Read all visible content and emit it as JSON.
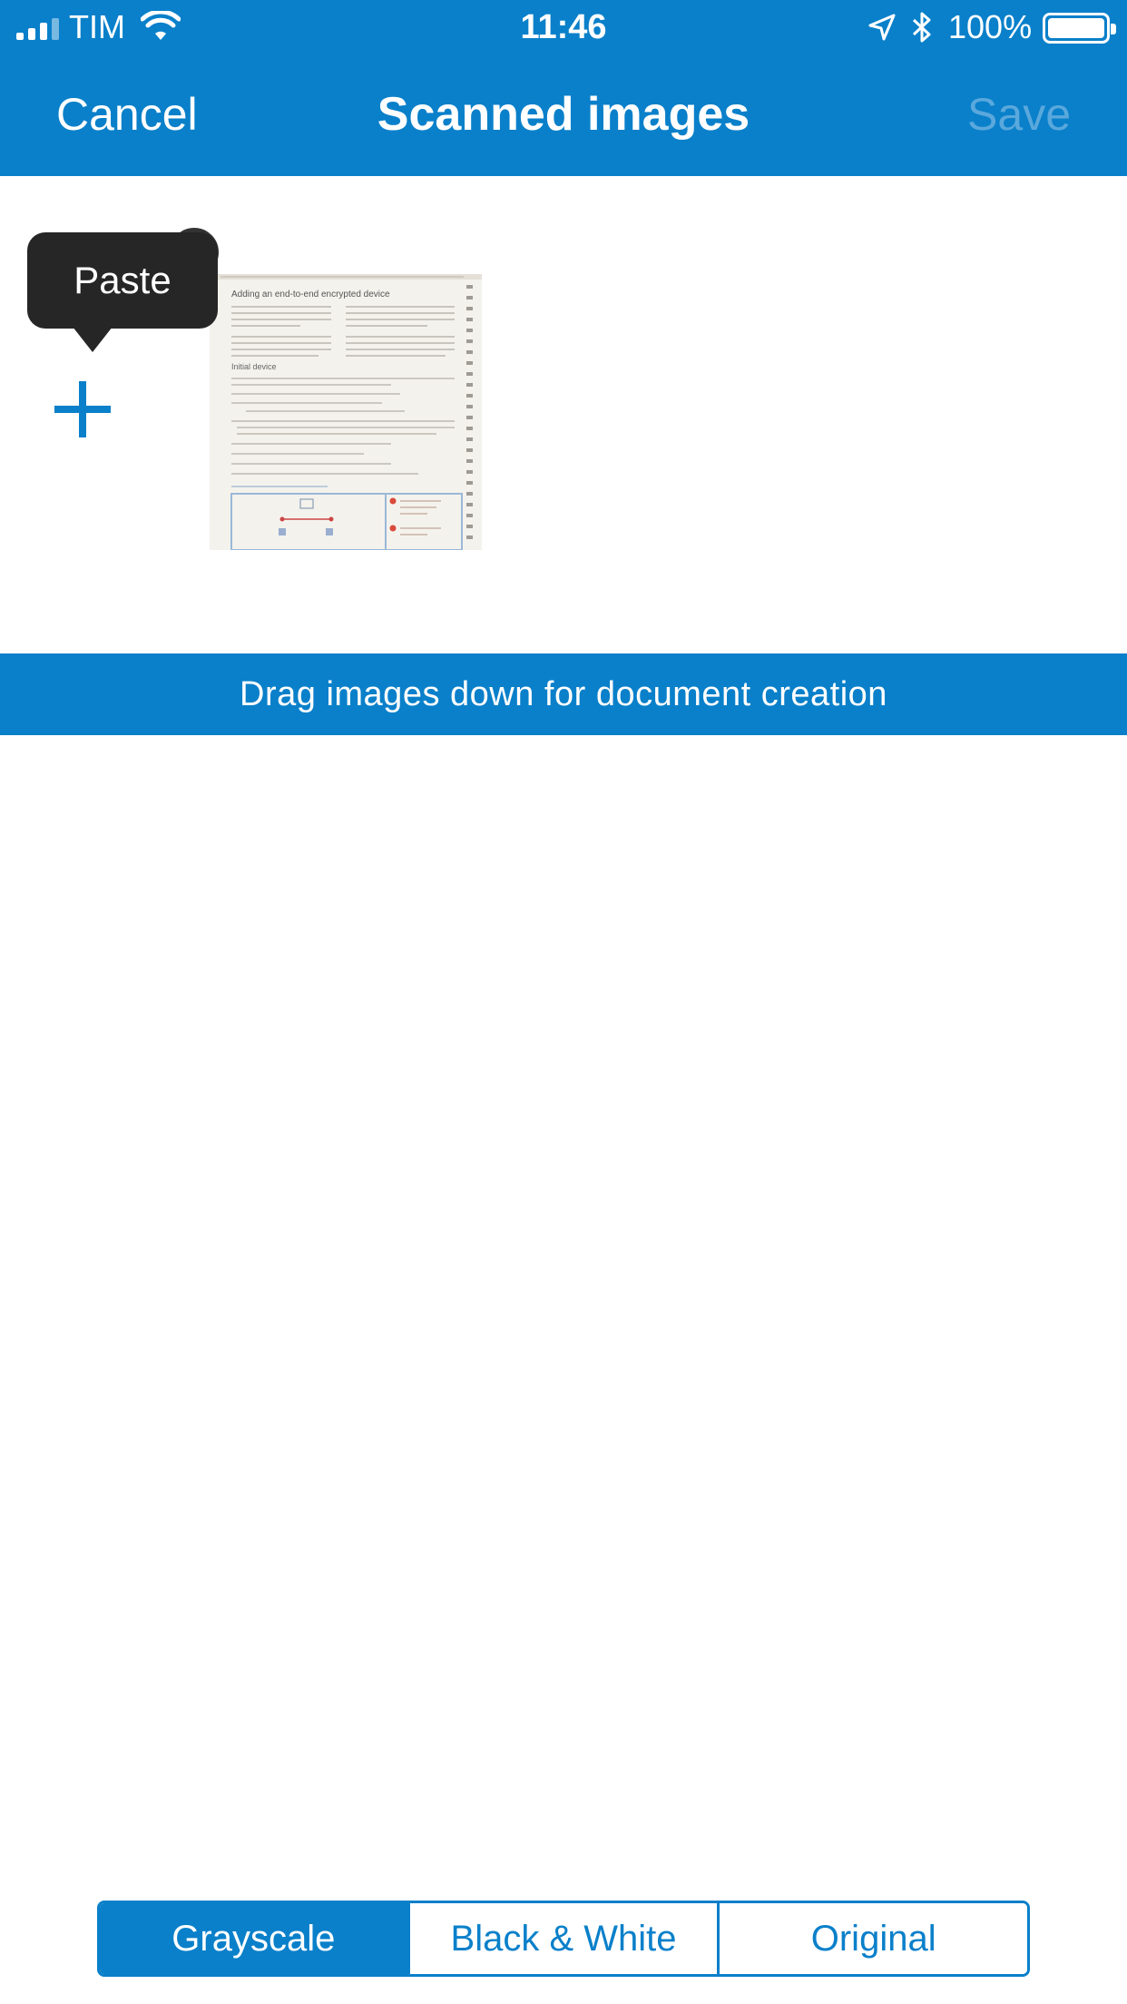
{
  "status_bar": {
    "carrier": "TIM",
    "time": "11:46",
    "battery_percent": "100%",
    "icons": [
      "signal-icon",
      "wifi-icon",
      "location-arrow-icon",
      "bluetooth-icon",
      "battery-icon"
    ]
  },
  "nav": {
    "cancel_label": "Cancel",
    "title": "Scanned images",
    "save_label": "Save"
  },
  "tray": {
    "add_icon": "plus-icon",
    "tooltip_label": "Paste",
    "thumbnail": {
      "page_heading": "Adding an end-to-end encrypted device",
      "section_heading": "Initial device"
    }
  },
  "banner": {
    "text": "Drag images down for document creation"
  },
  "filter_modes": {
    "options": [
      "Grayscale",
      "Black & White",
      "Original"
    ],
    "selected": "Grayscale"
  },
  "colors": {
    "accent": "#0a80ca",
    "save_disabled": "#5aa8dc",
    "tooltip_bg": "#262626"
  }
}
